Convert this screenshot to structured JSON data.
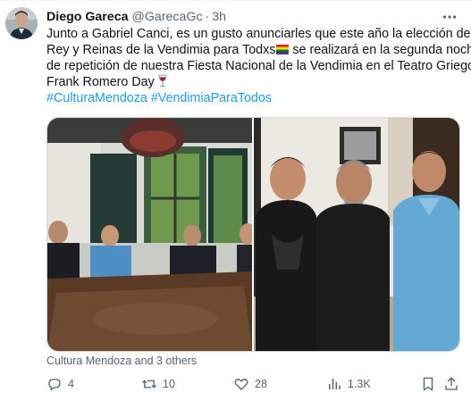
{
  "author": {
    "name": "Diego Gareca",
    "handle": "@GarecaGc",
    "separator": "·",
    "time": "3h"
  },
  "tweet": {
    "line1": "Junto a Gabriel Canci, es un gusto anunciarles que este año la elección del",
    "line2_before": "Rey y Reinas de la Vendimia para Todxs",
    "line2_flag_icon": "rainbow-flag-emoji",
    "line2_after": " se realizará en la segunda noche",
    "line3": "de repetición de nuestra Fiesta Nacional de la Vendimia en el Teatro Griego",
    "line4": "Frank Romero Day",
    "line4_icon": "wine-glass-emoji",
    "hashtags": "#CulturaMendoza #VendimiaParaTodos"
  },
  "media": {
    "left_photo": "group-photo-meeting-table",
    "right_photo": "group-photo-standing-three-men"
  },
  "tagged": "Cultura Mendoza and 3 others",
  "actions": {
    "reply": {
      "icon": "reply-icon",
      "count": "4"
    },
    "retweet": {
      "icon": "retweet-icon",
      "count": "10"
    },
    "like": {
      "icon": "heart-icon",
      "count": "28"
    },
    "views": {
      "icon": "views-icon",
      "count": "1.3K"
    },
    "share": {
      "icon": "share-icon"
    }
  },
  "colors": {
    "text": "#0f1419",
    "muted": "#536471",
    "link": "#1d9bf0",
    "border": "#cfd9de"
  }
}
